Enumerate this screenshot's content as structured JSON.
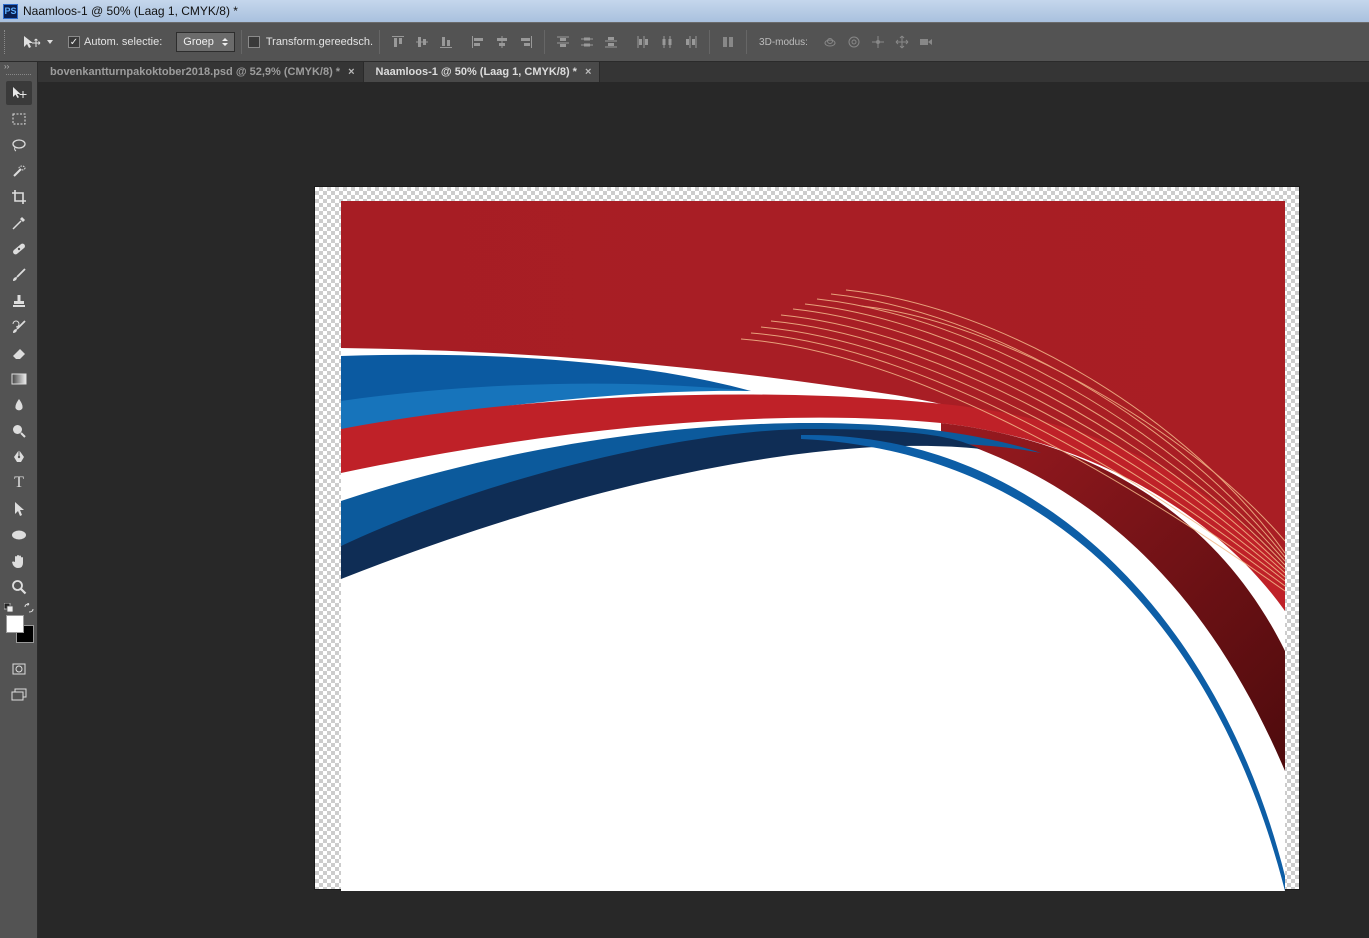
{
  "window": {
    "app_icon": "PS",
    "title": "Naamloos-1 @ 50% (Laag 1, CMYK/8) *"
  },
  "options_bar": {
    "tool_preset_icon": "move-tool-icon",
    "auto_select_label": "Autom. selectie:",
    "auto_select_checked": true,
    "auto_select_target": "Groep",
    "transform_label": "Transform.gereedsch.",
    "transform_checked": false,
    "mode_3d_label": "3D-modus:"
  },
  "tabs": [
    {
      "label": "bovenkantturnpakoktober2018.psd @ 52,9% (CMYK/8) *",
      "active": false
    },
    {
      "label": "Naamloos-1 @ 50% (Laag 1, CMYK/8) *",
      "active": true
    }
  ],
  "tab_close_glyph": "×",
  "tools": [
    "move-tool",
    "rectangular-marquee-tool",
    "lasso-tool",
    "quick-selection-tool",
    "crop-tool",
    "eyedropper-tool",
    "spot-healing-tool",
    "brush-tool",
    "clone-stamp-tool",
    "history-brush-tool",
    "eraser-tool",
    "gradient-tool",
    "blur-tool",
    "dodge-tool",
    "pen-tool",
    "type-tool",
    "path-selection-tool",
    "ellipse-tool",
    "hand-tool",
    "zoom-tool"
  ],
  "colors": {
    "foreground": "#ffffff",
    "background": "#000000",
    "art_red": "#a91e24",
    "art_blue": "#0d5ea6",
    "art_dark_blue": "#0f2d55"
  },
  "type_tool_glyph": "T"
}
